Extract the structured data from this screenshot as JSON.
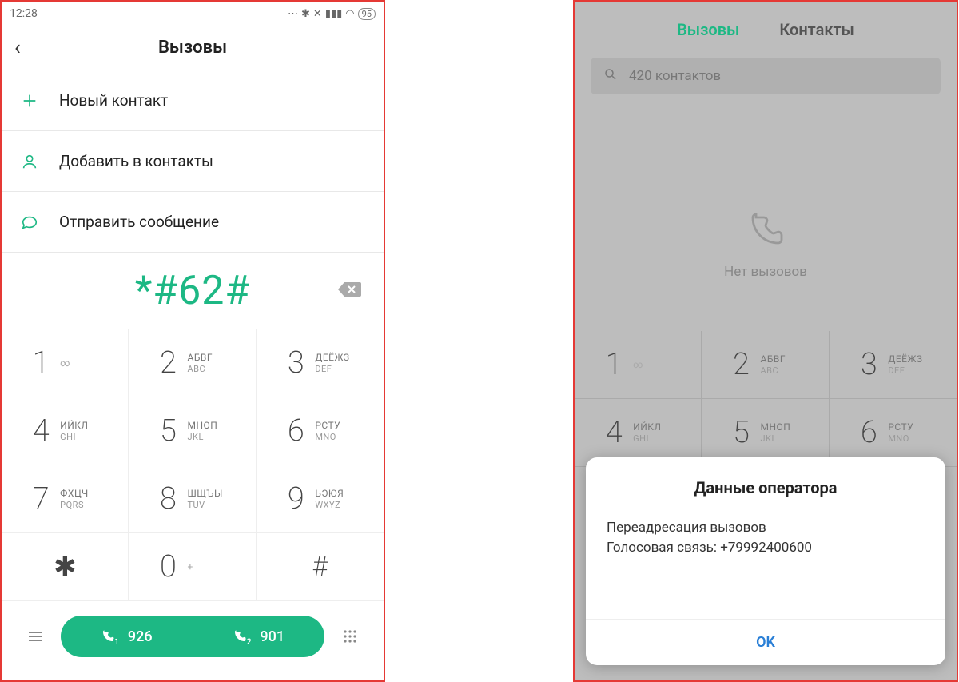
{
  "left": {
    "status": {
      "time": "12:28",
      "battery": "95"
    },
    "header": {
      "title": "Вызовы"
    },
    "actions": [
      {
        "icon": "plus-icon",
        "label": "Новый контакт"
      },
      {
        "icon": "person-icon",
        "label": "Добавить в контакты"
      },
      {
        "icon": "message-icon",
        "label": "Отправить сообщение"
      }
    ],
    "entered_number": "*#62#",
    "keypad": [
      {
        "digit": "1",
        "ru": "",
        "en": "",
        "sub": "∞"
      },
      {
        "digit": "2",
        "ru": "АБВГ",
        "en": "ABC",
        "sub": ""
      },
      {
        "digit": "3",
        "ru": "ДЕЁЖЗ",
        "en": "DEF",
        "sub": ""
      },
      {
        "digit": "4",
        "ru": "ИЙКЛ",
        "en": "GHI",
        "sub": ""
      },
      {
        "digit": "5",
        "ru": "МНОП",
        "en": "JKL",
        "sub": ""
      },
      {
        "digit": "6",
        "ru": "РСТУ",
        "en": "MNO",
        "sub": ""
      },
      {
        "digit": "7",
        "ru": "ФХЦЧ",
        "en": "PQRS",
        "sub": ""
      },
      {
        "digit": "8",
        "ru": "ШЩЪЫ",
        "en": "TUV",
        "sub": ""
      },
      {
        "digit": "9",
        "ru": "ЬЭЮЯ",
        "en": "WXYZ",
        "sub": ""
      },
      {
        "digit": "✱",
        "ru": "",
        "en": "",
        "sub": ""
      },
      {
        "digit": "0",
        "ru": "",
        "en": "",
        "sub": "+"
      },
      {
        "digit": "#",
        "ru": "",
        "en": "",
        "sub": ""
      }
    ],
    "call": {
      "sim1": "926",
      "sim2": "901"
    }
  },
  "right": {
    "tabs": {
      "active": "Вызовы",
      "inactive": "Контакты"
    },
    "search_text": "420 контактов",
    "empty_text": "Нет вызовов",
    "keypad_row1": [
      {
        "digit": "1",
        "ru": "",
        "en": "",
        "sub": "∞"
      },
      {
        "digit": "2",
        "ru": "АБВГ",
        "en": "ABC",
        "sub": ""
      },
      {
        "digit": "3",
        "ru": "ДЕЁЖЗ",
        "en": "DEF",
        "sub": ""
      }
    ],
    "keypad_row2": [
      {
        "digit": "4",
        "ru": "ИЙКЛ",
        "en": "GHI",
        "sub": ""
      },
      {
        "digit": "5",
        "ru": "МНОП",
        "en": "JKL",
        "sub": ""
      },
      {
        "digit": "6",
        "ru": "РСТУ",
        "en": "MNO",
        "sub": ""
      }
    ],
    "dialog": {
      "title": "Данные оператора",
      "line1": "Переадресация вызовов",
      "line2": "Голосовая связь: +79992400600",
      "ok": "OK"
    }
  }
}
